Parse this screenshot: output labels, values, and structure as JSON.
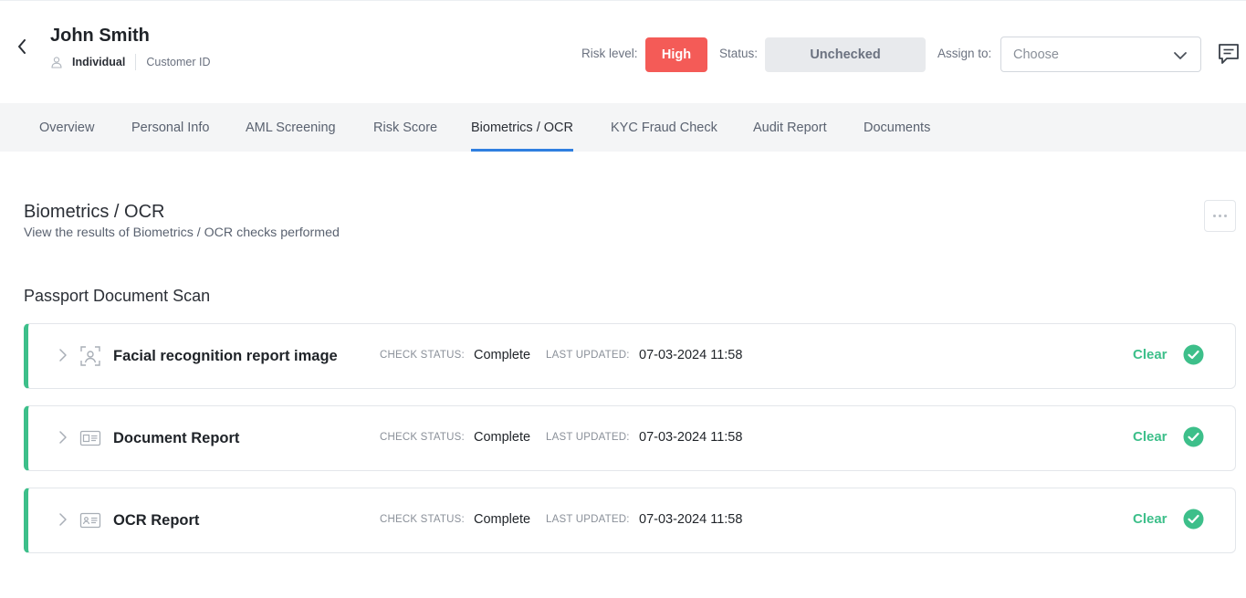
{
  "header": {
    "name": "John Smith",
    "entity_type": "Individual",
    "customer_id_label": "Customer ID",
    "risk_label": "Risk level:",
    "risk_value": "High",
    "status_label": "Status:",
    "status_value": "Unchecked",
    "assign_label": "Assign to:",
    "assign_placeholder": "Choose",
    "icons": {
      "back": "chevron-left-icon",
      "person": "person-icon",
      "dropdown": "chevron-down-icon",
      "comment": "comment-icon"
    },
    "colors": {
      "risk_high": "#f45b57",
      "status_bg": "#e8eaed"
    }
  },
  "tabs": [
    {
      "label": "Overview",
      "active": false
    },
    {
      "label": "Personal Info",
      "active": false
    },
    {
      "label": "AML Screening",
      "active": false
    },
    {
      "label": "Risk Score",
      "active": false
    },
    {
      "label": "Biometrics / OCR",
      "active": true
    },
    {
      "label": "KYC Fraud Check",
      "active": false
    },
    {
      "label": "Audit Report",
      "active": false
    },
    {
      "label": "Documents",
      "active": false
    }
  ],
  "main": {
    "title": "Biometrics / OCR",
    "subtitle": "View the results of Biometrics / OCR checks performed",
    "group_title": "Passport Document Scan",
    "check_status_label": "CHECK STATUS:",
    "last_updated_label": "LAST UPDATED:",
    "accent_color": "#3dbf8a",
    "checks": [
      {
        "title": "Facial recognition report image",
        "icon": "face-scan-icon",
        "status": "Complete",
        "updated": "07-03-2024 11:58",
        "result": "Clear"
      },
      {
        "title": "Document Report",
        "icon": "document-icon",
        "status": "Complete",
        "updated": "07-03-2024 11:58",
        "result": "Clear"
      },
      {
        "title": "OCR Report",
        "icon": "id-card-icon",
        "status": "Complete",
        "updated": "07-03-2024 11:58",
        "result": "Clear"
      }
    ]
  }
}
